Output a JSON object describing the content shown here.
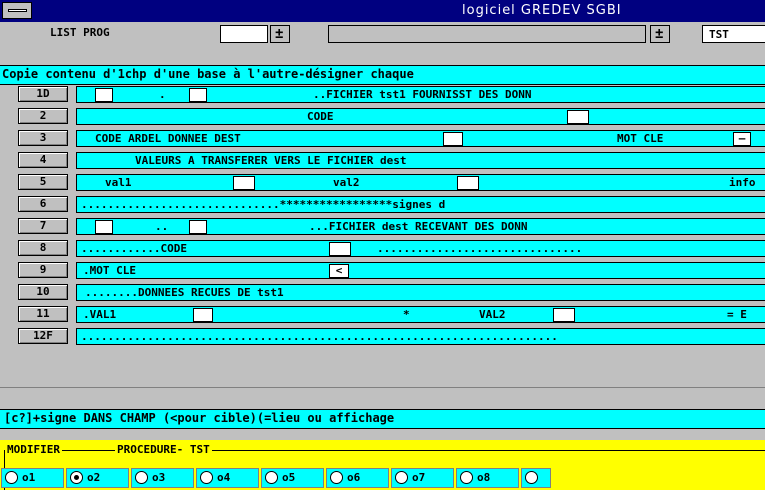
{
  "window": {
    "title": "logiciel GREDEV  SGBI"
  },
  "toolbar": {
    "list_label": "LIST PROG",
    "plusminus_1": "±",
    "plusminus_2": "±",
    "right_label": "TST"
  },
  "description": "Copie contenu d'1chp d'une base à l'autre-désigner chaque",
  "rows": [
    {
      "num": "1D",
      "parts": [
        ".",
        "..FICHIER tst1 FOURNISST DES DONN"
      ]
    },
    {
      "num": "2",
      "parts": [
        "CODE"
      ]
    },
    {
      "num": "3",
      "parts": [
        "CODE ARDEL DONNEE DEST",
        "MOT CLE",
        "—"
      ]
    },
    {
      "num": "4",
      "parts": [
        "VALEURS A TRANSFERER VERS LE FICHIER dest"
      ]
    },
    {
      "num": "5",
      "parts": [
        "val1",
        "val2",
        "info"
      ]
    },
    {
      "num": "6",
      "parts": [
        "..............................*****************signes d"
      ]
    },
    {
      "num": "7",
      "parts": [
        "..",
        "...FICHIER dest RECEVANT DES DONN"
      ]
    },
    {
      "num": "8",
      "parts": [
        "............CODE",
        "..............................."
      ]
    },
    {
      "num": "9",
      "parts": [
        ".MOT CLE",
        "<"
      ]
    },
    {
      "num": "10",
      "parts": [
        "........DONNEES RECUES DE tst1"
      ]
    },
    {
      "num": "11",
      "parts": [
        ".VAL1",
        "*",
        "VAL2",
        "= E"
      ]
    },
    {
      "num": "12F",
      "parts": [
        "........................................................................"
      ]
    }
  ],
  "status": "[c?]+signe DANS CHAMP (<pour cible)(=lieu ou affichage",
  "group": {
    "label_1": "MODIFIER",
    "label_2": "PROCEDURE- TST",
    "options": [
      "o1",
      "o2",
      "o3",
      "o4",
      "o5",
      "o6",
      "o7",
      "o8"
    ],
    "selected": "o2"
  }
}
